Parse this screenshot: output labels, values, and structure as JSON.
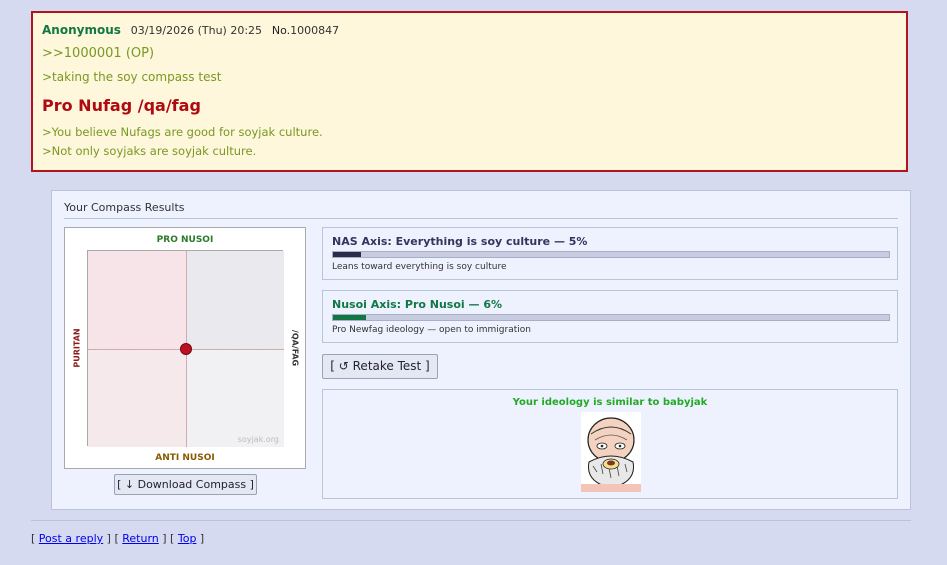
{
  "post": {
    "name": "Anonymous",
    "date": "03/19/2026 (Thu) 20:25",
    "no_label": "No.",
    "no_value": "1000847",
    "quote_link": ">>1000001 (OP)",
    "greentext1": ">taking the soy compass test",
    "title": "Pro Nufag /qa/fag",
    "greentext2": ">You believe Nufags are good for soyjak culture.",
    "greentext3": ">Not only soyjaks are soyjak culture."
  },
  "results": {
    "title": "Your Compass Results",
    "compass": {
      "top_label": "PRO NUSOI",
      "bottom_label": "ANTI NUSOI",
      "left_label": "PURITAN",
      "right_label": "/QA/FAG",
      "watermark": "soyjak.org",
      "marker": {
        "x_percent": 5,
        "y_percent": 6
      },
      "marker_color": "#c01020"
    },
    "download_button": "[ ↓ Download Compass ]",
    "axes": [
      {
        "title": "NAS Axis: Everything is soy culture — 5%",
        "value_percent": 5,
        "description": "Leans toward everything is soy culture"
      },
      {
        "title": "Nusoi Axis: Pro Nusoi — 6%",
        "value_percent": 6,
        "description": "Pro Newfag ideology — open to immigration"
      }
    ],
    "retake_button": "[ ↺ Retake Test ]",
    "similar_text": "Your ideology is similar to babyjak",
    "similar_image_icon": "babyjak-face"
  },
  "footer": {
    "open1": "[",
    "post_reply": "Post a reply",
    "mid1": "] [",
    "return": "Return",
    "mid2": "] [",
    "top": "Top",
    "close": "]"
  },
  "colors": {
    "background": "#d6daf0",
    "post_border": "#b0141e",
    "post_bg": "#fef7dc",
    "greentext": "#789922",
    "title_red": "#af0a0f",
    "name_green": "#117743"
  }
}
